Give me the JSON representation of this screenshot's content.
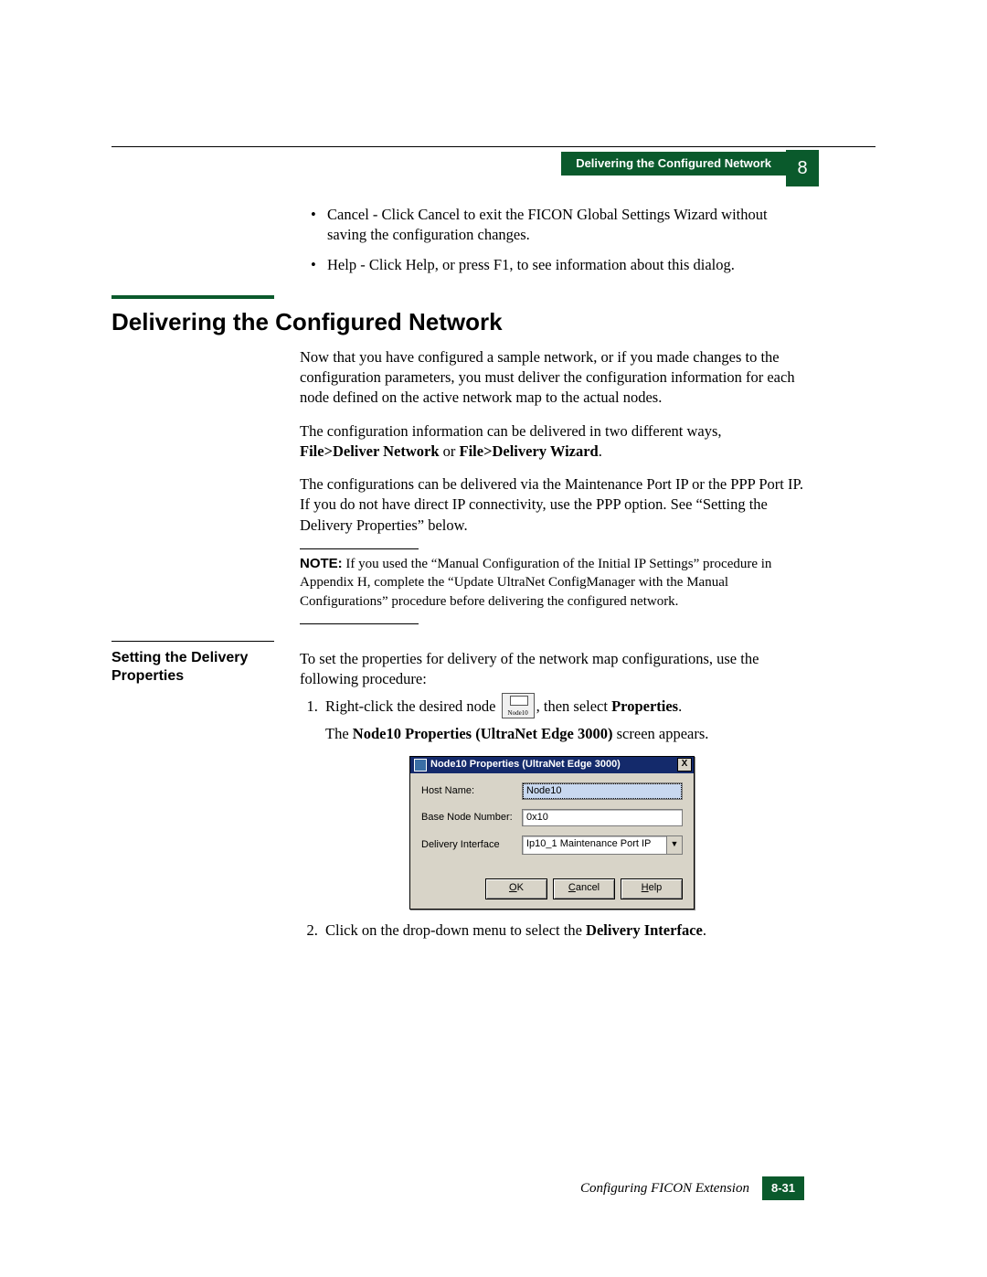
{
  "header": {
    "running_title": "Delivering the Configured Network",
    "chapter_number": "8"
  },
  "intro_bullets": [
    "Cancel - Click Cancel to exit the FICON Global Settings Wizard without saving the configuration changes.",
    "Help - Click Help, or press F1, to see information about this dialog."
  ],
  "section": {
    "title": "Delivering the Configured Network",
    "p1": "Now that you have configured a sample network, or if you made changes to the configuration parameters, you must deliver the configuration information for each node defined on the active network map to the actual nodes.",
    "p2_a": "The configuration information can be delivered in two different ways, ",
    "p2_b": "File>Deliver Network",
    "p2_c": " or ",
    "p2_d": "File>Delivery Wizard",
    "p2_e": ".",
    "p3": "The configurations can be delivered via the Maintenance Port IP or the PPP Port IP. If you do not have direct IP connectivity, use the PPP option. See “Setting the Delivery Properties” below.",
    "note_label": "NOTE:",
    "note": " If you used the “Manual Configuration of the Initial IP Settings” procedure in Appendix H, complete the “Update UltraNet ConfigManager with the Manual Configurations” procedure before delivering the configured network."
  },
  "sub": {
    "head": "Setting the Delivery Properties",
    "intro": "To set the properties for delivery of the network map configurations, use the following procedure:",
    "step1_a": "Right-click the desired node ",
    "step1_icon_label": "Node10",
    "step1_b": ", then select ",
    "step1_c": "Properties",
    "step1_d": ".",
    "step1_result_a": "The ",
    "step1_result_b": "Node10 Properties (UltraNet Edge 3000)",
    "step1_result_c": " screen appears.",
    "step2_a": "Click on the drop-down menu to select the ",
    "step2_b": "Delivery Interface",
    "step2_c": "."
  },
  "dialog": {
    "title": "Node10 Properties (UltraNet Edge 3000)",
    "close": "X",
    "fields": {
      "host_label": "Host Name:",
      "host_value": "Node10",
      "base_label": "Base Node Number:",
      "base_value": "0x10",
      "iface_label": "Delivery Interface",
      "iface_value": "Ip10_1 Maintenance Port IP"
    },
    "buttons": {
      "ok": "OK",
      "cancel": "Cancel",
      "help": "Help"
    }
  },
  "footer": {
    "text": "Configuring FICON Extension",
    "page": "8-31"
  }
}
